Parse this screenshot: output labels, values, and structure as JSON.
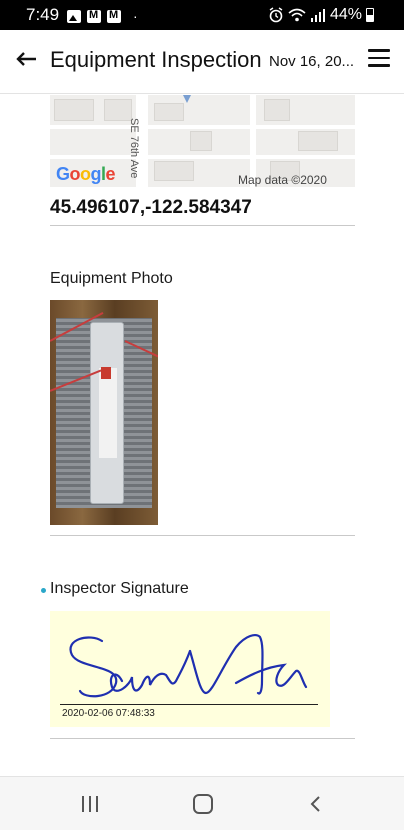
{
  "status_bar": {
    "time": "7:49",
    "battery_text": "44%",
    "dot": "·"
  },
  "app_bar": {
    "title": "Equipment Inspection",
    "subtitle": "Nov 16, 20..."
  },
  "map": {
    "street_label": "SE 76th Ave",
    "logo_text": "Google",
    "attribution": "Map data ©2020"
  },
  "location": {
    "coordinates": "45.496107,-122.584347"
  },
  "photo_section": {
    "label": "Equipment Photo"
  },
  "signature_section": {
    "label": "Inspector Signature",
    "timestamp": "2020-02-06 07:48:33"
  },
  "colors": {
    "accent": "#2aa7c9",
    "signature_ink": "#1f2fb0",
    "signature_bg": "#ffffdd"
  },
  "icons": {
    "back": "arrow-left-icon",
    "menu": "hamburger-menu-icon",
    "nav_recents": "recents-icon",
    "nav_home": "home-icon",
    "nav_back": "chevron-left-icon"
  }
}
